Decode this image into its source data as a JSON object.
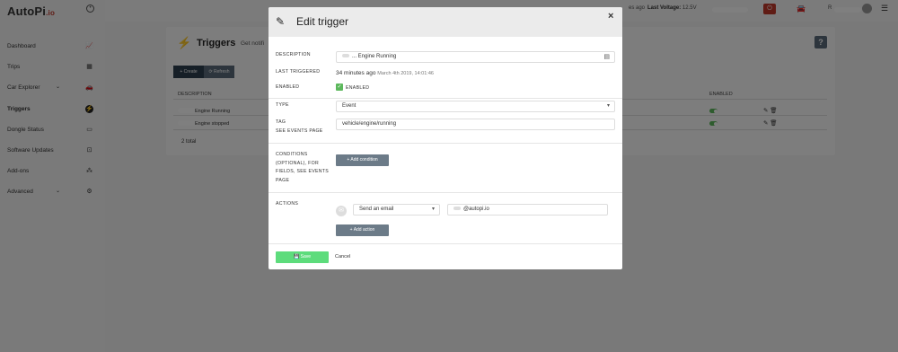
{
  "app": {
    "logo": "AutoPi",
    "logo_suffix": ".io"
  },
  "topbar": {
    "ago": "es ago",
    "voltage_label": "Last Voltage:",
    "voltage_value": "12.5V",
    "user_initial": "R"
  },
  "sidebar": {
    "items": [
      {
        "label": "Dashboard",
        "icon": "chart-icon",
        "glyph": "📈"
      },
      {
        "label": "Trips",
        "icon": "map-icon",
        "glyph": "▦"
      },
      {
        "label": "Car Explorer",
        "icon": "car-icon",
        "glyph": "🚗",
        "chevron": "⌄"
      },
      {
        "label": "Triggers",
        "icon": "bolt-icon",
        "glyph": "⚡",
        "active": true
      },
      {
        "label": "Dongle Status",
        "icon": "dongle-icon",
        "glyph": "▭"
      },
      {
        "label": "Software Updates",
        "icon": "update-icon",
        "glyph": "⊡"
      },
      {
        "label": "Add-ons",
        "icon": "addons-icon",
        "glyph": "⁂"
      },
      {
        "label": "Advanced",
        "icon": "cogs-icon",
        "glyph": "⚙",
        "chevron": "⌄"
      }
    ]
  },
  "triggers_page": {
    "title": "Triggers",
    "subtitle": "Get notifi",
    "help": "?",
    "create_label": "+ Create",
    "refresh_label": "⟳ Refresh",
    "columns": {
      "description": "DESCRIPTION",
      "enabled": "ENABLED"
    },
    "rows": [
      {
        "label": "Engine Running",
        "enabled": true
      },
      {
        "label": "Engine stopped",
        "enabled": true
      }
    ],
    "total": "2 total"
  },
  "modal": {
    "title": "Edit trigger",
    "close": "×",
    "description_label": "DESCRIPTION",
    "description_value": "... Engine Running",
    "last_triggered_label": "LAST TRIGGERED",
    "last_triggered_relative": "34 minutes ago",
    "last_triggered_absolute": "March 4th 2019, 14:01:46",
    "enabled_label": "ENABLED",
    "enabled_checkbox_label": "ENABLED",
    "type_label": "TYPE",
    "type_value": "Event",
    "tag_label": "TAG",
    "tag_hint": "SEE EVENTS PAGE",
    "tag_value": "vehicle/engine/running",
    "conditions_label": "CONDITIONS (OPTIONAL), FOR FIELDS, SEE EVENTS PAGE",
    "add_condition_label": "+ Add condition",
    "actions_label": "ACTIONS",
    "action_type": "Send an email",
    "action_email": "@autopi.io",
    "add_action_label": "+ Add action",
    "save_label": "Save",
    "cancel_label": "Cancel"
  },
  "colors": {
    "accent_green": "#5ddc7c",
    "enabled_green": "#5cb85c",
    "button_grey": "#6c7b88",
    "dark_button": "#2d3e4e"
  }
}
